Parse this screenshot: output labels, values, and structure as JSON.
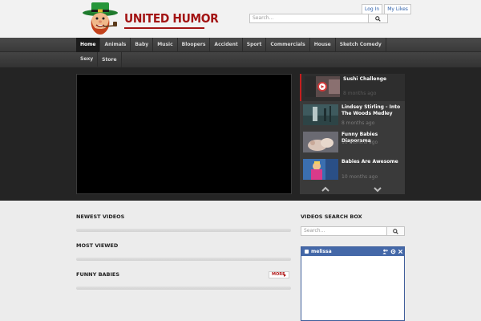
{
  "header": {
    "logo_text": "UNITED HUMOR",
    "top_links": [
      {
        "label": "Log In"
      },
      {
        "label": "My Likes"
      }
    ],
    "search_placeholder": "Search..."
  },
  "nav": {
    "items": [
      "Home",
      "Animals",
      "Baby",
      "Music",
      "Bloopers",
      "Accident",
      "Sport",
      "Commercials",
      "House",
      "Sketch Comedy",
      "Sexy",
      "Store"
    ],
    "active": "Home"
  },
  "playlist": {
    "items": [
      {
        "title": "Sushi Challenge",
        "time": "8 months ago"
      },
      {
        "title": "Lindsey Stirling - Into The Woods Medley",
        "time": "8 months ago"
      },
      {
        "title": "Funny Babies Diaporama",
        "time": "10 months ago"
      },
      {
        "title": "Babies Are Awesome",
        "time": "10 months ago"
      }
    ]
  },
  "sections": {
    "newest": "NEWEST VIDEOS",
    "most_viewed": "MOST VIEWED",
    "funny_babies": "FUNNY BABIES",
    "more_label": "MORE"
  },
  "sidebar": {
    "search_title": "VIDEOS SEARCH BOX",
    "search_placeholder": "Search...",
    "chat_name": "melissa"
  },
  "colors": {
    "brand_red": "#a31414",
    "nav_bg": "#3b3b3b",
    "hero_bg": "#242424",
    "chat_blue": "#4468a8"
  }
}
